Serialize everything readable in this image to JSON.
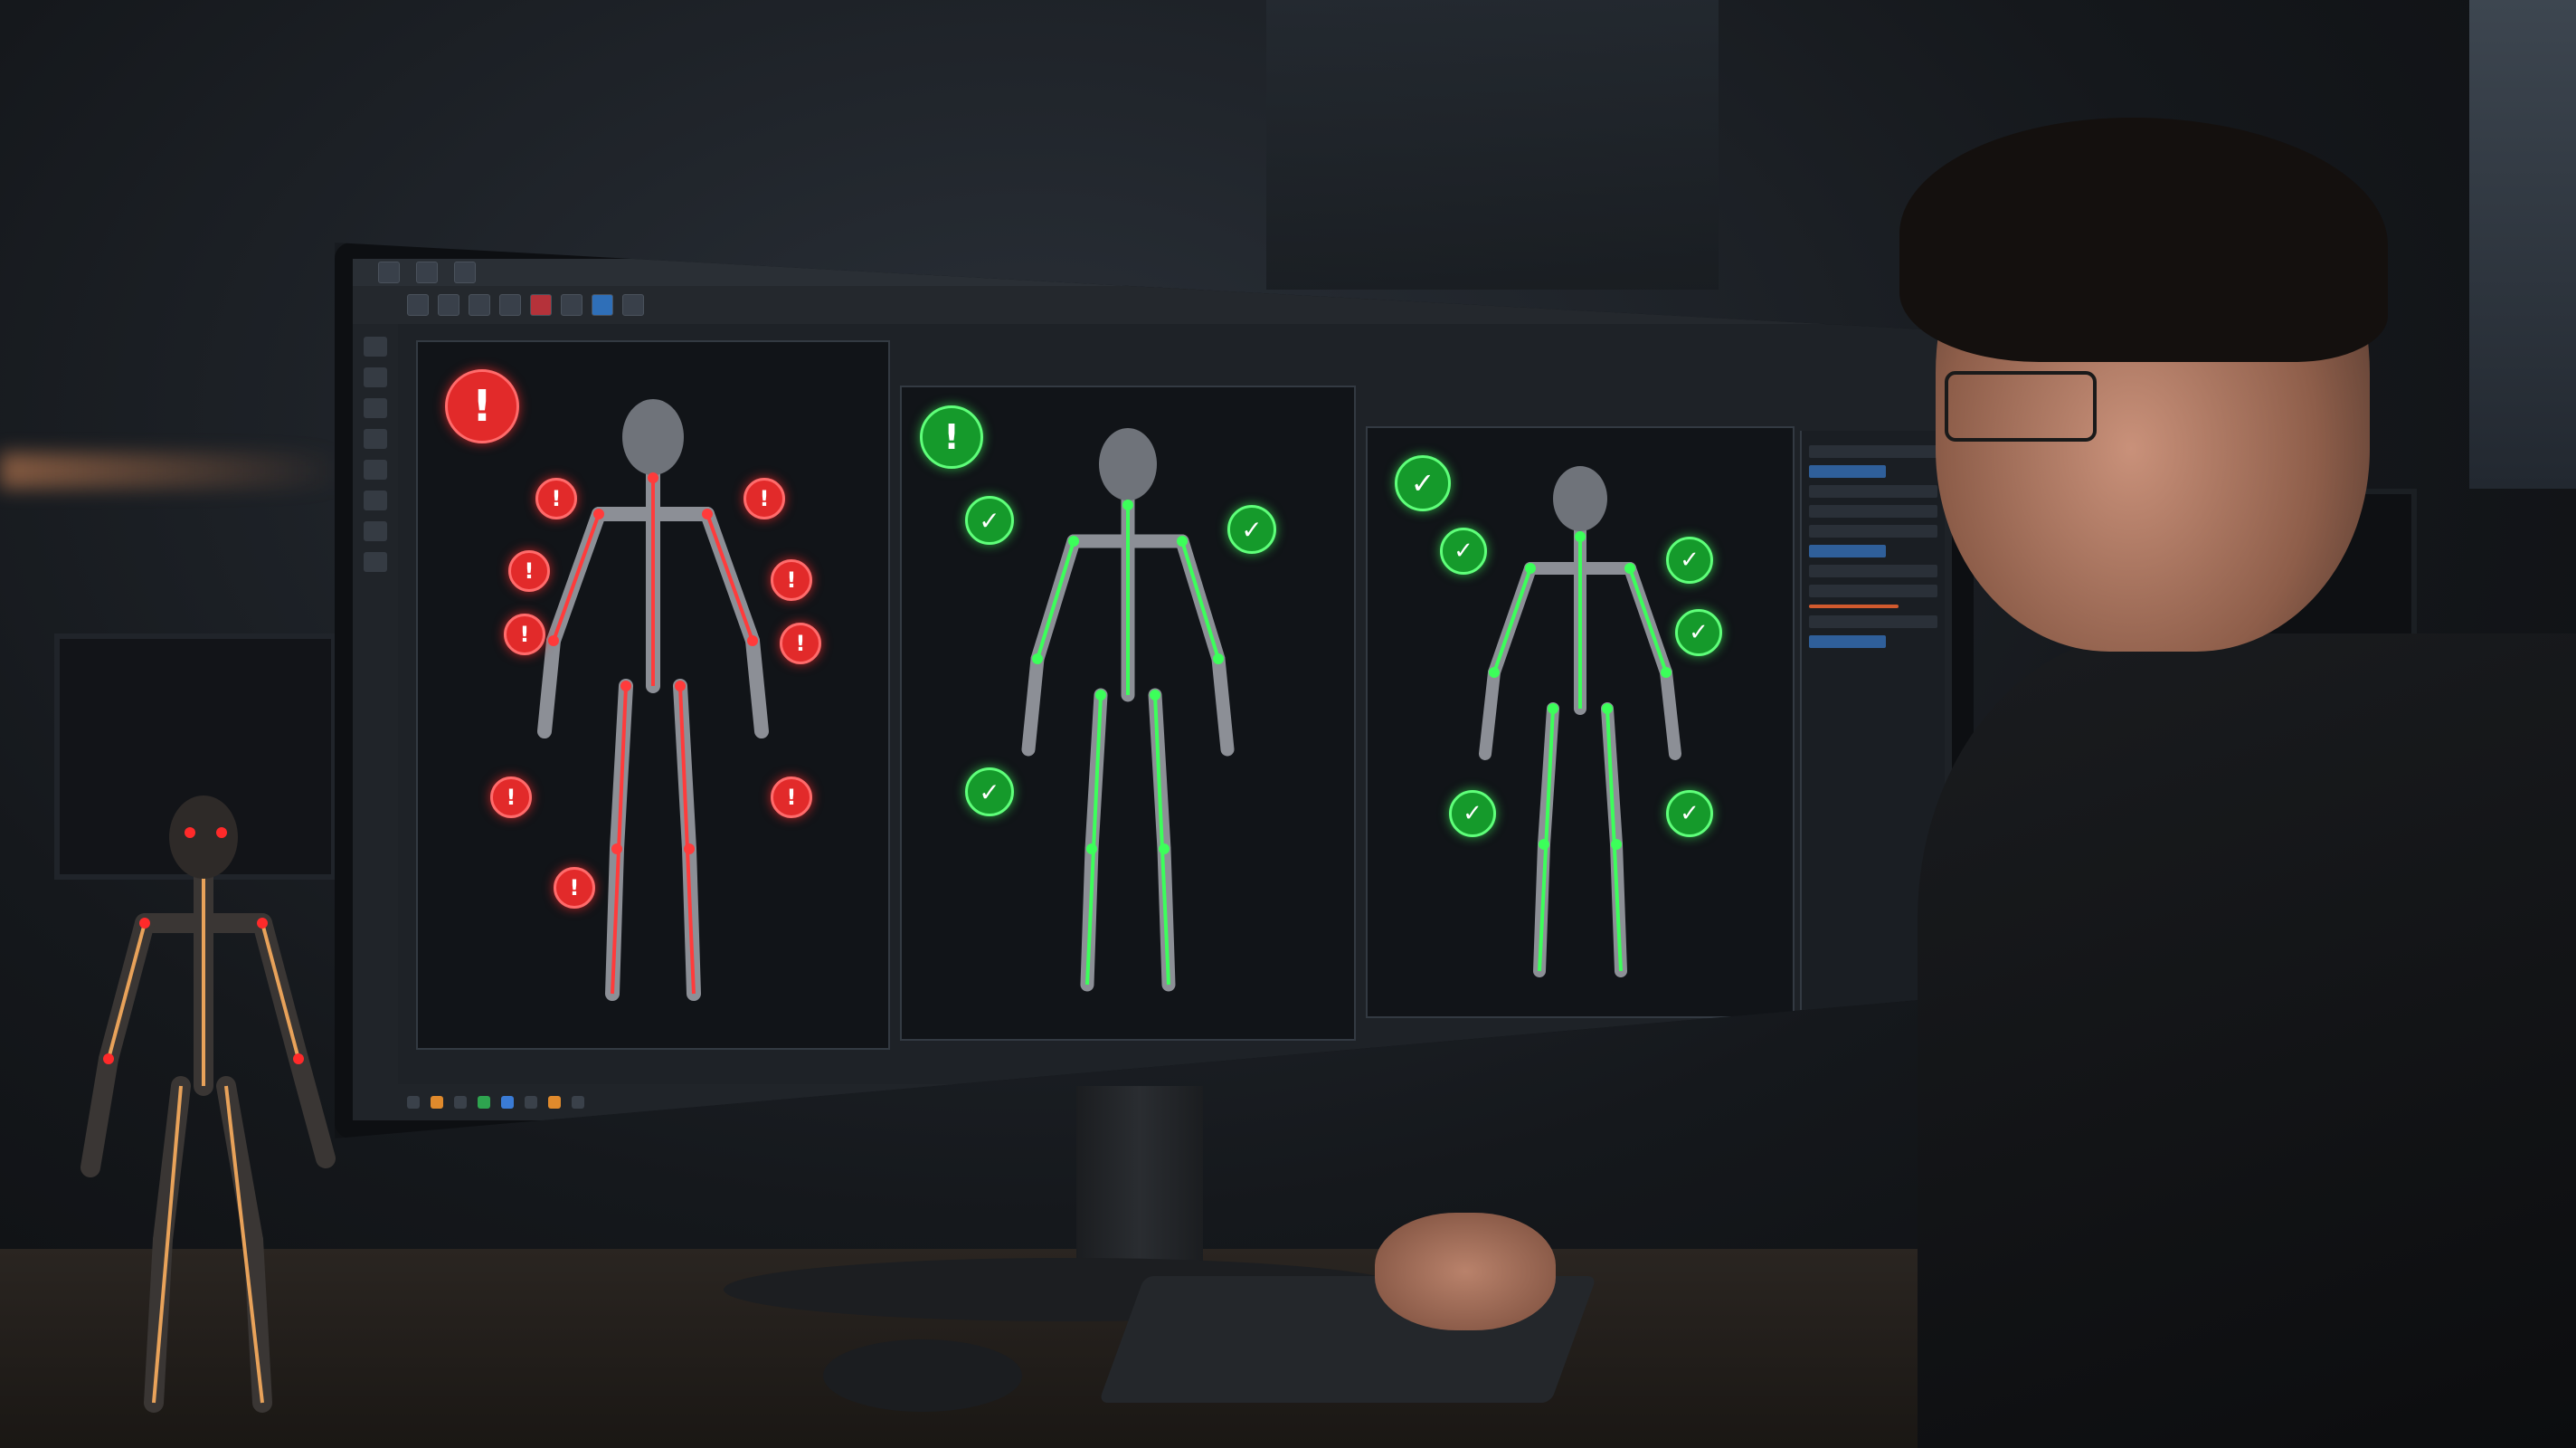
{
  "scene": {
    "description_visible_text": "",
    "accent_colors": {
      "error": "#e22a2a",
      "ok": "#159a2b",
      "panel": "#1e2227"
    }
  },
  "viewports": [
    {
      "status": "error",
      "icon": "warning-icon",
      "rig_color": "#ff3b3b"
    },
    {
      "status": "ok",
      "icon": "check-icon",
      "rig_color": "#3cff5a"
    },
    {
      "status": "ok",
      "icon": "check-icon",
      "rig_color": "#3cff5a"
    }
  ],
  "glyphs": {
    "error": "!",
    "ok": "✓"
  }
}
